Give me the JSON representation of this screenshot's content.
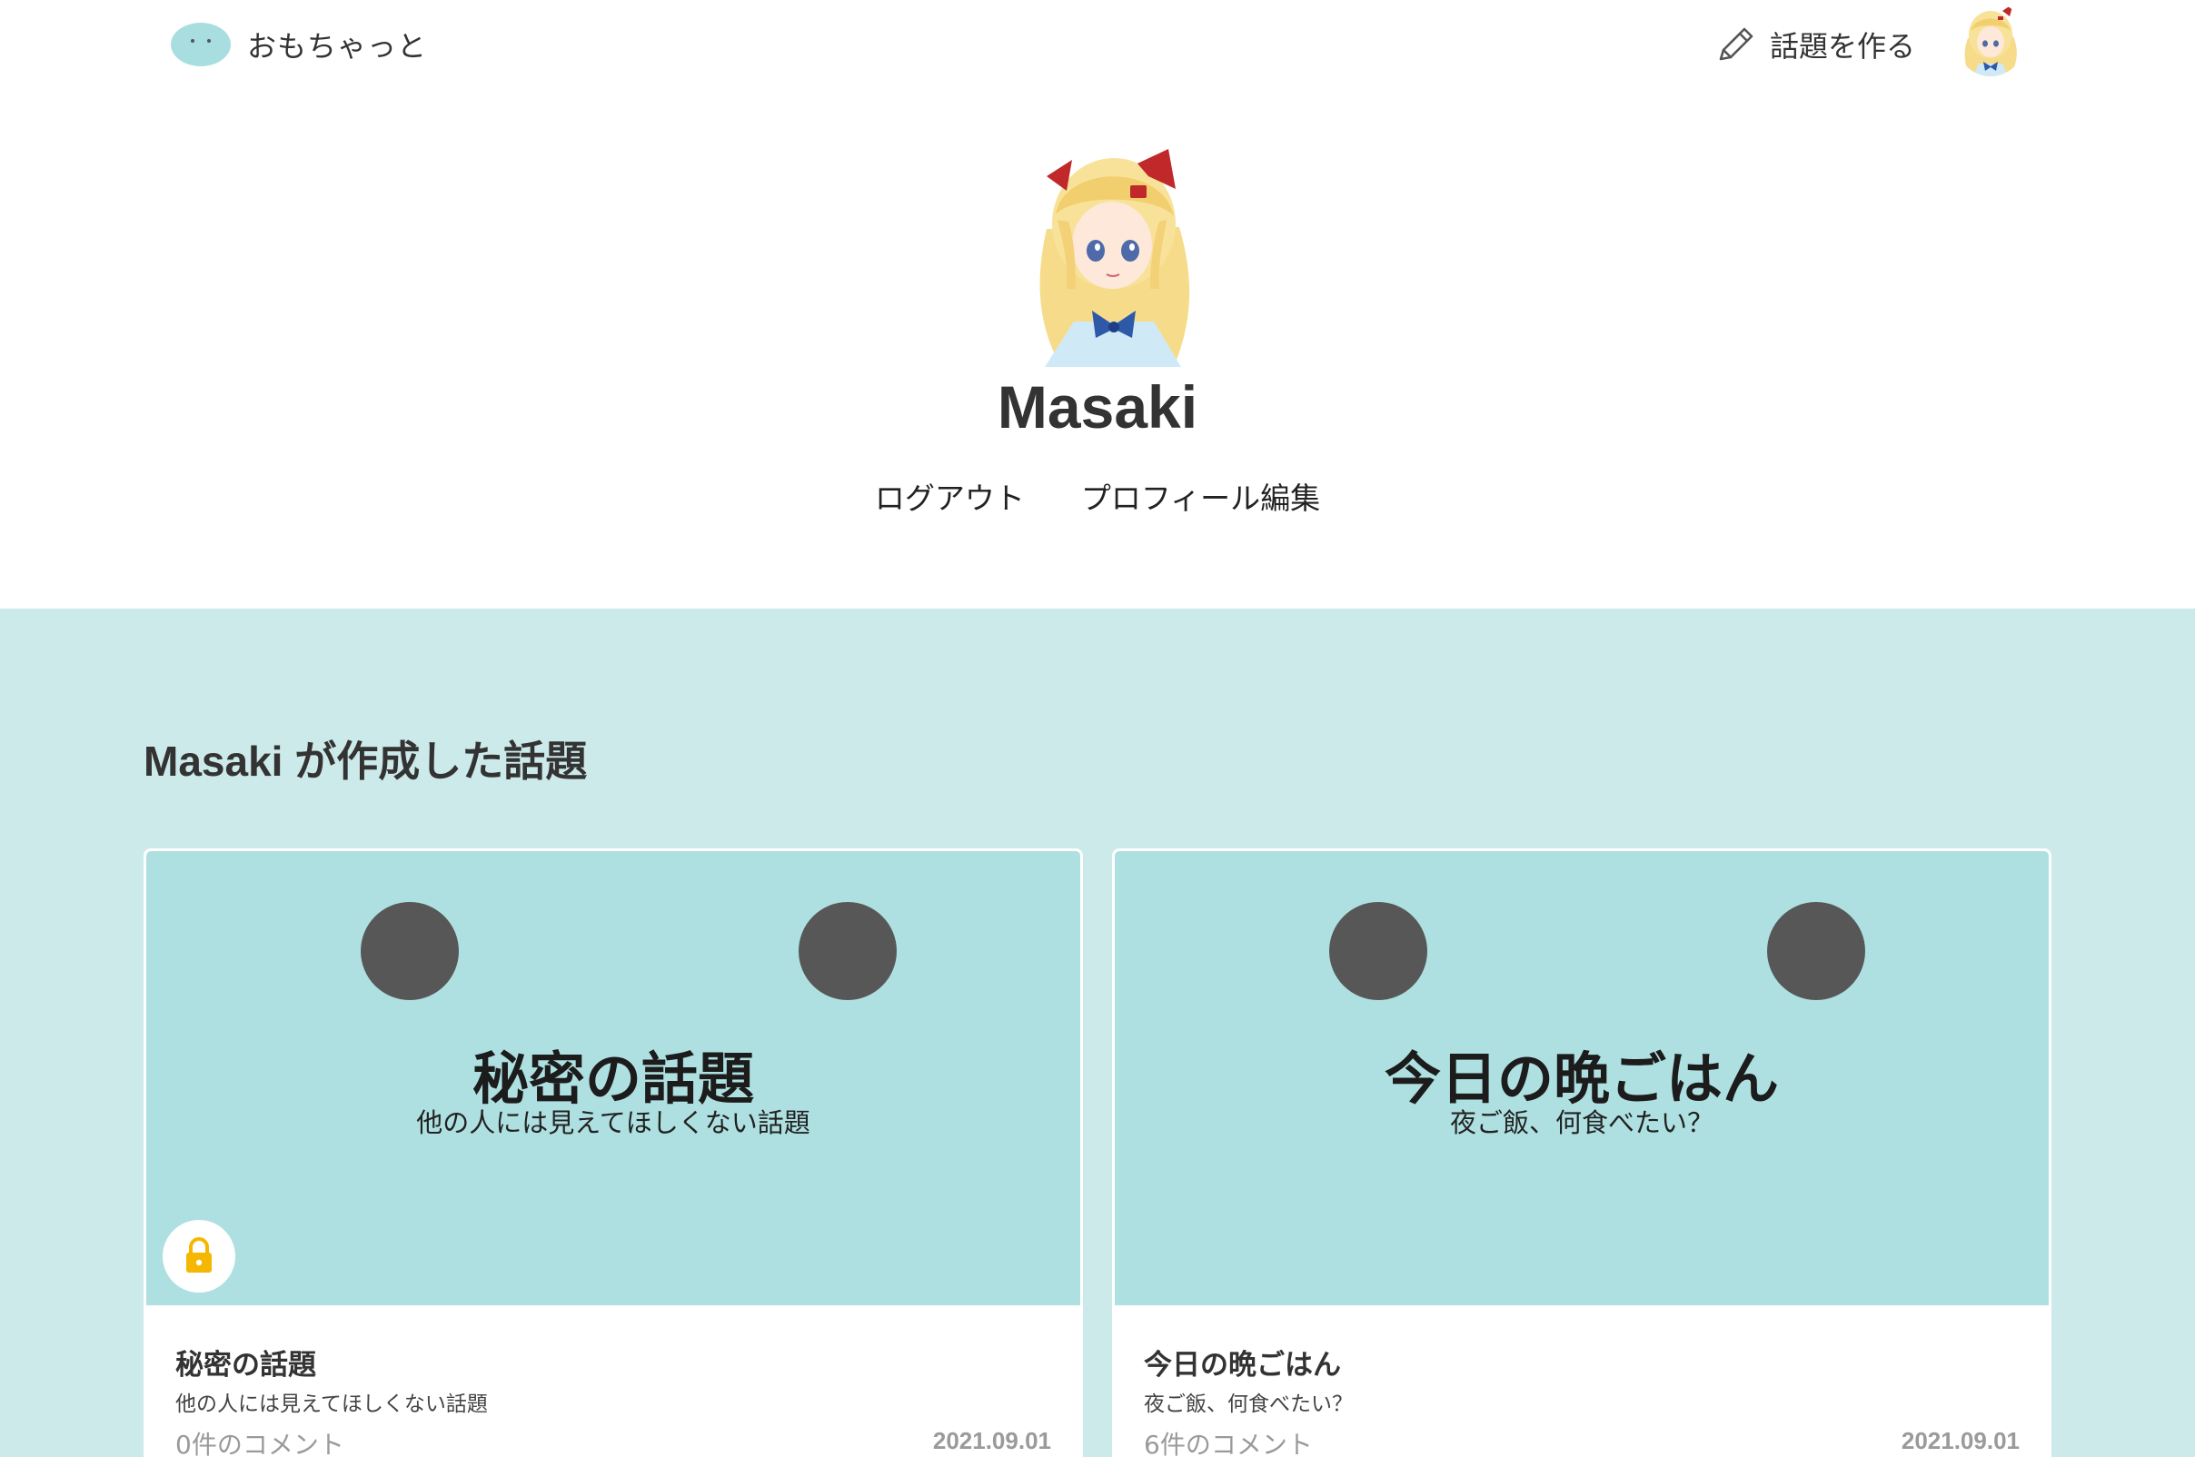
{
  "header": {
    "brand_name": "おもちゃっと",
    "create_topic_label": "話題を作る",
    "avatar_icon": "anime-girl-avatar"
  },
  "profile": {
    "name": "Masaki",
    "logout_label": "ログアウト",
    "edit_profile_label": "プロフィール編集"
  },
  "topics_section": {
    "title": "Masaki が作成した話題",
    "background": "#cdeaea",
    "cards": [
      {
        "thumb_title": "秘密の話題",
        "thumb_subtitle": "他の人には見えてほしくない話題",
        "title": "秘密の話題",
        "description": "他の人には見えてほしくない話題",
        "comments": "0件のコメント",
        "date": "2021.09.01",
        "locked": true
      },
      {
        "thumb_title": "今日の晩ごはん",
        "thumb_subtitle": "夜ご飯、何食べたい？",
        "title": "今日の晩ごはん",
        "description": "夜ご飯、何食べたい？",
        "comments": "6件のコメント",
        "date": "2021.09.01",
        "locked": false
      }
    ]
  },
  "colors": {
    "accent": "#afe0e1",
    "lock": "#f5b700"
  }
}
